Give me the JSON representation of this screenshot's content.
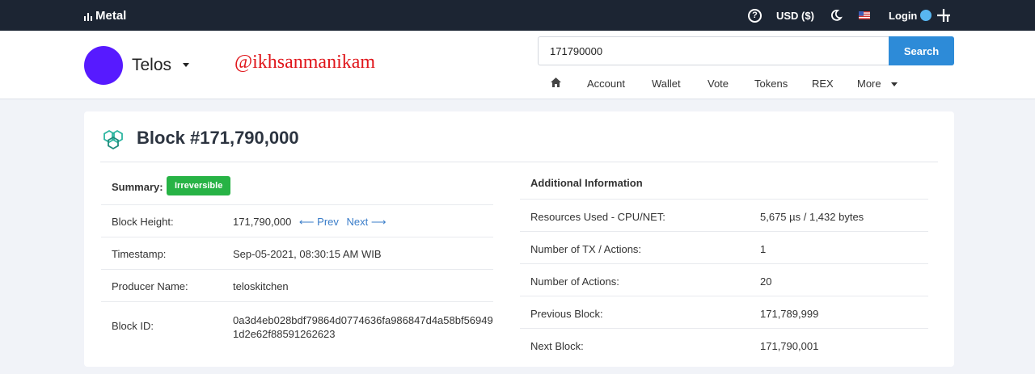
{
  "topbar": {
    "brand": "Metal",
    "currency": "USD ($)",
    "login": "Login",
    "icons": [
      "help-icon",
      "moon-icon",
      "flag-icon",
      "plus-icon"
    ]
  },
  "header": {
    "chain_name": "Telos",
    "watermark": "@ikhsanmanikam",
    "search_value": "171790000",
    "search_button": "Search",
    "nav": [
      "Account",
      "Wallet",
      "Vote",
      "Tokens",
      "REX",
      "More"
    ]
  },
  "block": {
    "title": "Block #171,790,000",
    "summary_label": "Summary:",
    "summary_badge": "Irreversible",
    "left_rows": [
      {
        "label": "Block Height:",
        "value": "171,790,000"
      },
      {
        "label": "Timestamp:",
        "value": "Sep-05-2021, 08:30:15 AM WIB"
      },
      {
        "label": "Producer Name:",
        "value": "teloskitchen"
      },
      {
        "label": "Block ID:",
        "value_line1": "0a3d4eb028bdf79864d0774636fa986847d4a58bf56949",
        "value_line2": "1d2e62f88591262623"
      }
    ],
    "prev_label": "⟵ Prev",
    "next_label": "Next ⟶",
    "additional_title": "Additional Information",
    "right_rows": [
      {
        "label": "Resources Used - CPU/NET:",
        "value": "5,675 µs / 1,432 bytes"
      },
      {
        "label": "Number of TX / Actions:",
        "value": "1"
      },
      {
        "label": "Number of Actions:",
        "value": "20"
      },
      {
        "label": "Previous Block:",
        "value": "171,789,999"
      },
      {
        "label": "Next Block:",
        "value": "171,790,001"
      }
    ]
  },
  "colors": {
    "topbar_bg": "#1c2533",
    "accent_blue": "#2d8bd8",
    "link": "#3a7dc9",
    "badge_green": "#27b345",
    "chain_avatar": "#571aff",
    "watermark_red": "#e0161b"
  }
}
